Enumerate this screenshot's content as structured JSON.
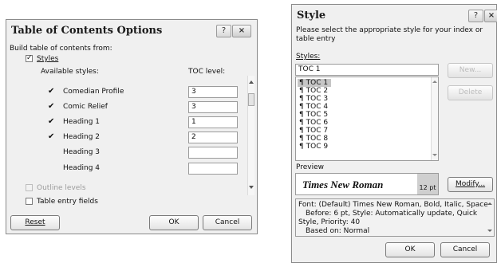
{
  "toc": {
    "title": "Table of Contents Options",
    "help_label": "?",
    "close_label": "×",
    "build_label": "Build table of contents from:",
    "styles_check_label": "Styles",
    "available_header": "Available styles:",
    "toc_level_header": "TOC level:",
    "styles": [
      {
        "name": "Comedian Profile",
        "checked": true,
        "level": "3"
      },
      {
        "name": "Comic Relief",
        "checked": true,
        "level": "3"
      },
      {
        "name": "Heading 1",
        "checked": true,
        "level": "1"
      },
      {
        "name": "Heading 2",
        "checked": true,
        "level": "2"
      },
      {
        "name": "Heading 3",
        "checked": false,
        "level": ""
      },
      {
        "name": "Heading 4",
        "checked": false,
        "level": ""
      }
    ],
    "outline_label": "Outline levels",
    "entry_fields_label": "Table entry fields",
    "reset_label": "Reset",
    "ok_label": "OK",
    "cancel_label": "Cancel"
  },
  "style": {
    "title": "Style",
    "help_label": "?",
    "close_label": "×",
    "instruction": "Please select the appropriate style for your index or table entry",
    "styles_label": "Styles:",
    "style_name_value": "TOC 1",
    "pilcrow": "¶",
    "list_items": [
      "TOC 1",
      "TOC 2",
      "TOC 3",
      "TOC 4",
      "TOC 5",
      "TOC 6",
      "TOC 7",
      "TOC 8",
      "TOC 9"
    ],
    "new_label": "New...",
    "delete_label": "Delete",
    "preview_label": "Preview",
    "preview_font": "Times New Roman",
    "preview_size": "12 pt",
    "modify_label": "Modify...",
    "description_lines": [
      "Font: (Default) Times New Roman, Bold, Italic, Space",
      "Before:  6 pt, Style: Automatically update, Quick",
      "Style, Priority: 40",
      "Based on: Normal"
    ],
    "ok_label": "OK",
    "cancel_label": "Cancel"
  }
}
